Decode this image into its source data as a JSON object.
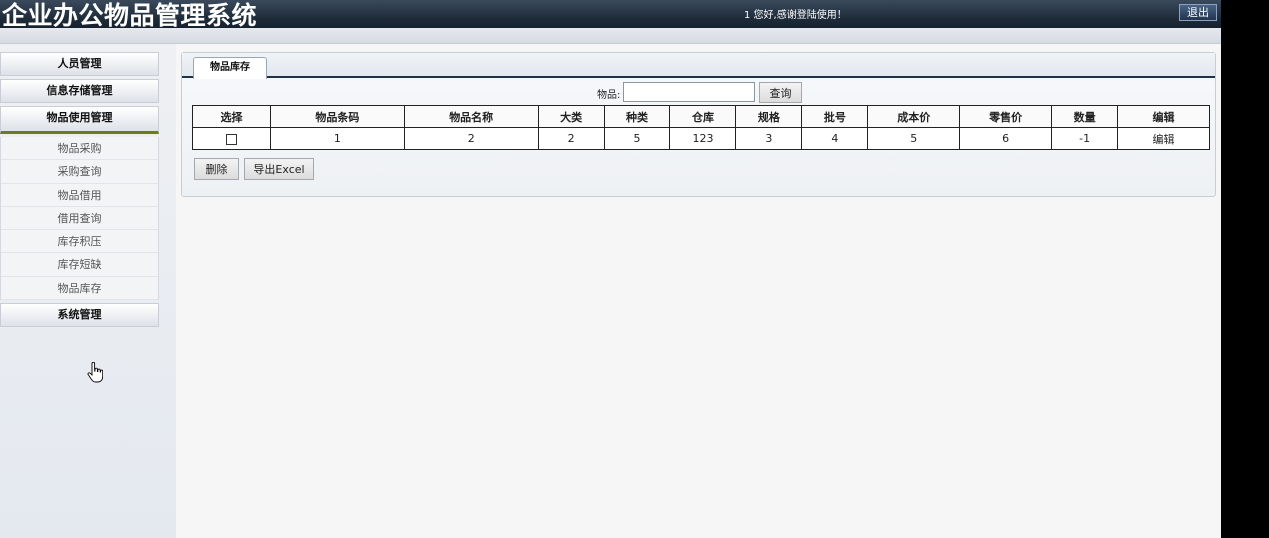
{
  "header": {
    "title": "企业办公物品管理系统",
    "welcome": "1 您好,感谢登陆使用！",
    "logout_label": "退出"
  },
  "sidebar": {
    "menus": [
      {
        "label": "人员管理",
        "active": false
      },
      {
        "label": "信息存储管理",
        "active": false
      },
      {
        "label": "物品使用管理",
        "active": true
      },
      {
        "label": "系统管理",
        "active": false
      }
    ],
    "submenu": [
      "物品采购",
      "采购查询",
      "物品借用",
      "借用查询",
      "库存积压",
      "库存短缺",
      "物品库存"
    ]
  },
  "main": {
    "tab_label": "物品库存",
    "search": {
      "label": "物品:",
      "value": "",
      "button": "查询"
    },
    "table": {
      "headers": [
        "选择",
        "物品条码",
        "物品名称",
        "大类",
        "种类",
        "仓库",
        "规格",
        "批号",
        "成本价",
        "零售价",
        "数量",
        "编辑"
      ],
      "rows": [
        {
          "checked": false,
          "cells": [
            "1",
            "2",
            "2",
            "5",
            "123",
            "3",
            "4",
            "5",
            "6",
            "-1"
          ],
          "edit_label": "编辑"
        }
      ]
    },
    "delete_label": "删除",
    "export_label": "导出Excel"
  },
  "colors": {
    "header_bg": "#1d2a38",
    "active_menu_border": "#6b7d14",
    "tab_underline": "#1f3147"
  }
}
